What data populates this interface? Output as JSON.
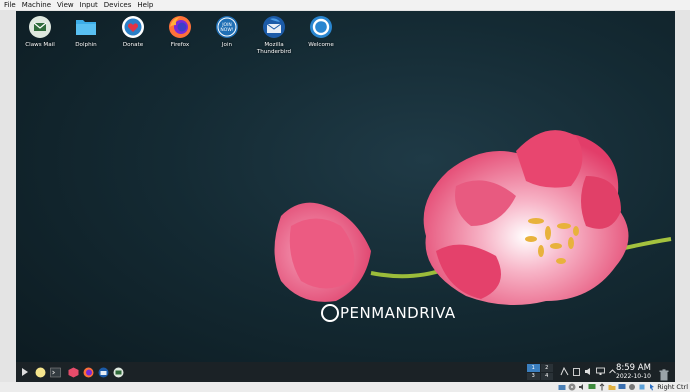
{
  "vm_menu": [
    "File",
    "Machine",
    "View",
    "Input",
    "Devices",
    "Help"
  ],
  "desktop_icons": [
    {
      "label": "Claws Mail"
    },
    {
      "label": "Dolphin"
    },
    {
      "label": "Donate"
    },
    {
      "label": "Firefox"
    },
    {
      "label": "Join"
    },
    {
      "label": "Mozilla Thunderbird"
    },
    {
      "label": "Welcome"
    }
  ],
  "wallpaper": {
    "brand": "OpenMandriva",
    "logo_text": "PENMANDRIVA"
  },
  "taskbar": {
    "pager": [
      "1",
      "2",
      "3",
      "4"
    ],
    "active_desktop": "1",
    "time": "8:59 AM",
    "date": "2022-10-10"
  },
  "vm_status": {
    "host_key": "Right Ctrl"
  },
  "colors": {
    "taskbar": "#1b2226",
    "accent": "#3b7fbf",
    "petal": "#e9456f"
  }
}
